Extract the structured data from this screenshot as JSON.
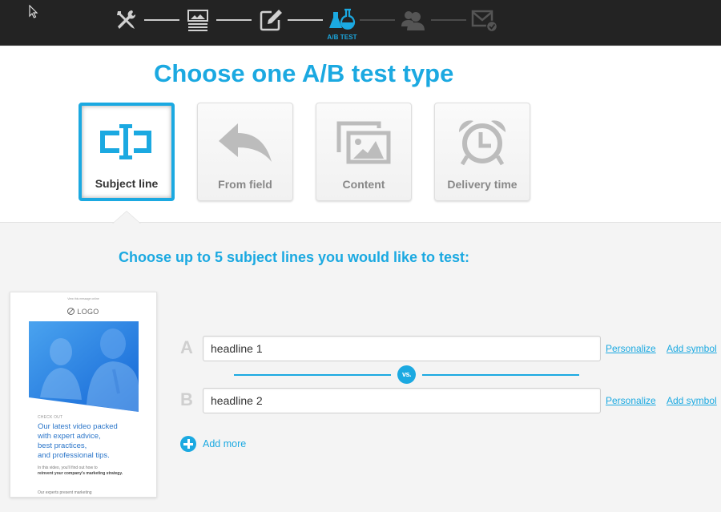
{
  "wizard": {
    "steps": [
      {
        "name": "settings",
        "icon": "tools-icon",
        "state": "done"
      },
      {
        "name": "template",
        "icon": "template-icon",
        "state": "done"
      },
      {
        "name": "editor",
        "icon": "edit-icon",
        "state": "done"
      },
      {
        "name": "ab-test",
        "icon": "flask-icon",
        "state": "active",
        "label": "A/B TEST"
      },
      {
        "name": "recipients",
        "icon": "contacts-icon",
        "state": "pending"
      },
      {
        "name": "send",
        "icon": "mail-check-icon",
        "state": "pending"
      }
    ],
    "active_label": "A/B TEST",
    "accent_color": "#1ba9e1"
  },
  "page": {
    "title": "Choose one A/B test type",
    "test_types": [
      {
        "label": "Subject line",
        "icon": "subject-line-icon",
        "selected": true
      },
      {
        "label": "From field",
        "icon": "reply-arrow-icon",
        "selected": false
      },
      {
        "label": "Content",
        "icon": "images-icon",
        "selected": false
      },
      {
        "label": "Delivery time",
        "icon": "alarm-clock-icon",
        "selected": false
      }
    ],
    "subtitle": "Choose up to 5 subject lines you would like to test:"
  },
  "preview": {
    "top_line": "View this message online",
    "logo": "LOGO",
    "eyebrow": "CHECK OUT",
    "headline": [
      "Our latest video packed",
      "with expert advice,",
      "best practices,",
      "and professional tips."
    ],
    "body_intro": "In this video, you'll find out how to",
    "body_bold": "reinvent your company's marketing strategy.",
    "footer": "Our experts present marketing"
  },
  "variants": [
    {
      "letter": "A",
      "value": "headline 1",
      "personalize": "Personalize",
      "add_symbol": "Add symbol"
    },
    {
      "letter": "B",
      "value": "headline 2",
      "personalize": "Personalize",
      "add_symbol": "Add symbol"
    }
  ],
  "vs_label": "vs.",
  "add_more_label": "Add more"
}
